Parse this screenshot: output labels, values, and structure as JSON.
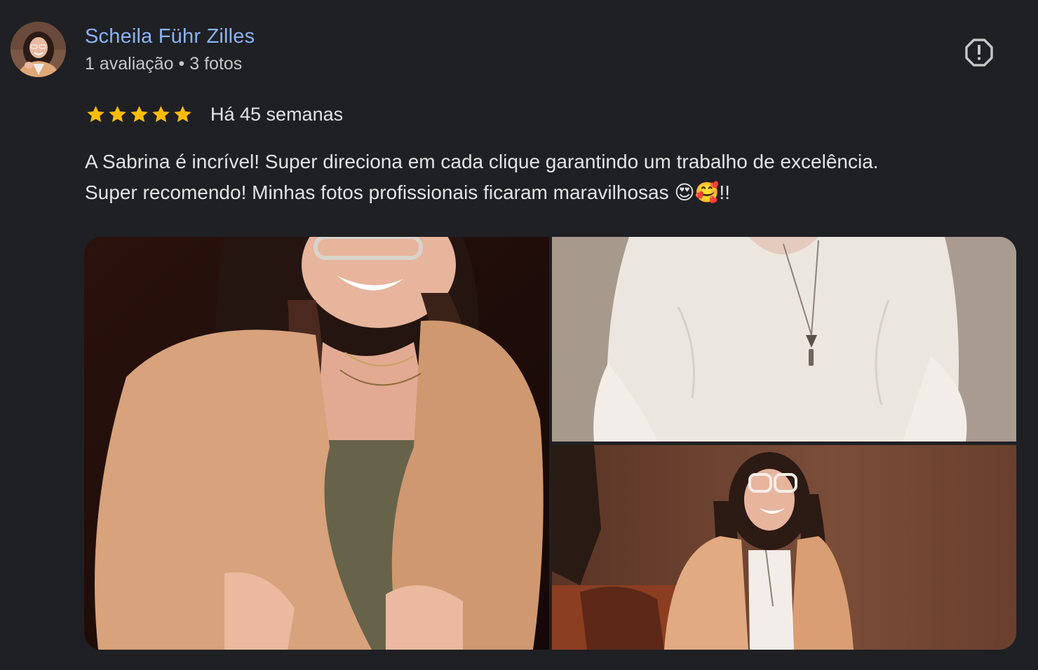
{
  "review": {
    "author": {
      "name": "Scheila Führ Zilles",
      "review_count": "1 avaliação",
      "separator": "•",
      "photo_count": "3 fotos"
    },
    "rating": 5,
    "rating_max": 5,
    "date": "Há 45 semanas",
    "text_line1": "A Sabrina é incrível! Super direciona em cada clique garantindo um trabalho de excelência.",
    "text_line2": "Super recomendo! Minhas fotos profissionais ficaram maravilhosas 😍🥰!!",
    "photos": [
      {
        "alt": "photo-1"
      },
      {
        "alt": "photo-2"
      },
      {
        "alt": "photo-3"
      }
    ],
    "icons": {
      "report": "report-flag-icon",
      "star": "star-icon"
    }
  },
  "colors": {
    "background": "#1f2024",
    "author_name": "#8ab4f8",
    "meta_text": "#c4c7c5",
    "body_text": "#e3e3e3",
    "star": "#fbbc04"
  }
}
